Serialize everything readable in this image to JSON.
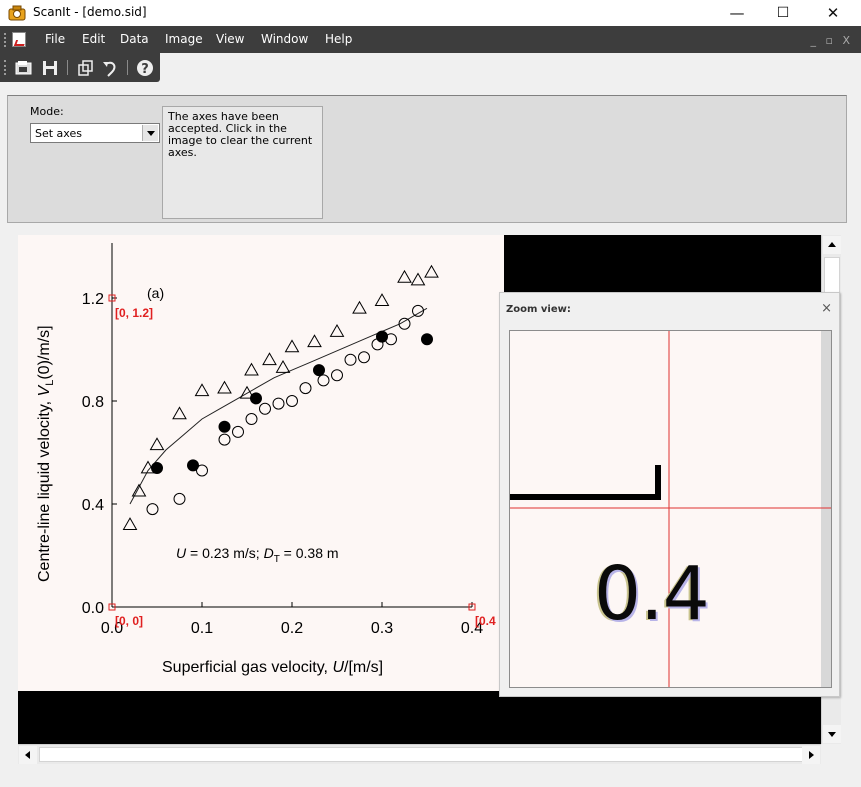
{
  "window": {
    "title": "ScanIt - [demo.sid]",
    "min_glyph": "—",
    "max_glyph": "☐",
    "close_glyph": "✕"
  },
  "menu": {
    "items": [
      "File",
      "Edit",
      "Data",
      "Image",
      "View",
      "Window",
      "Help"
    ],
    "mdi_controls": "_ ▫ X"
  },
  "toolbar": {
    "buttons": [
      "open-icon",
      "save-icon",
      "copy-icon",
      "undo-icon",
      "help-icon"
    ]
  },
  "mode": {
    "label": "Mode:",
    "selected": "Set axes",
    "message": "The axes have been accepted. Click in the image to clear the current axes."
  },
  "zoom": {
    "title": "Zoom view:",
    "close": "×",
    "enlarged_text": "0.4"
  },
  "chart_data": {
    "type": "scatter",
    "panel_label": "(a)",
    "xlabel_text": "Superficial gas velocity, ",
    "xlabel_var": "U",
    "xlabel_unit": "/[m/s]",
    "ylabel_text": "Centre-line liquid velocity, ",
    "ylabel_var": "V",
    "ylabel_sub": "L",
    "ylabel_unit": "(0)/m/s]",
    "annotation": {
      "u_label": "U",
      "u_value": " = 0.23 m/s; ",
      "d_label": "D",
      "d_sub": "T",
      "d_value": " = 0.38 m"
    },
    "xlim": [
      0,
      0.4
    ],
    "ylim": [
      0,
      1.2
    ],
    "x_ticks": [
      "0.0",
      "0.1",
      "0.2",
      "0.3",
      "0.4"
    ],
    "y_ticks": [
      "0.0",
      "0.4",
      "0.8",
      "1.2"
    ],
    "axis_markers": [
      "[0, 1.2]",
      "[0, 0]",
      "[0.4"
    ],
    "series": [
      {
        "marker": "triangle",
        "x": [
          0.02,
          0.03,
          0.04,
          0.05,
          0.075,
          0.1,
          0.125,
          0.15,
          0.155,
          0.175,
          0.19,
          0.2,
          0.225,
          0.25,
          0.275,
          0.3,
          0.325,
          0.34,
          0.355
        ],
        "y": [
          0.32,
          0.45,
          0.54,
          0.63,
          0.75,
          0.84,
          0.85,
          0.83,
          0.92,
          0.96,
          0.93,
          1.01,
          1.03,
          1.07,
          1.16,
          1.19,
          1.28,
          1.27,
          1.3
        ]
      },
      {
        "marker": "circle-open",
        "x": [
          0.045,
          0.075,
          0.1,
          0.125,
          0.14,
          0.155,
          0.17,
          0.185,
          0.2,
          0.215,
          0.235,
          0.25,
          0.265,
          0.28,
          0.295,
          0.31,
          0.325,
          0.34
        ],
        "y": [
          0.38,
          0.42,
          0.53,
          0.65,
          0.68,
          0.73,
          0.77,
          0.79,
          0.8,
          0.85,
          0.88,
          0.9,
          0.96,
          0.97,
          1.02,
          1.04,
          1.1,
          1.15
        ]
      },
      {
        "marker": "circle-filled",
        "x": [
          0.05,
          0.09,
          0.125,
          0.16,
          0.23,
          0.3,
          0.35
        ],
        "y": [
          0.54,
          0.55,
          0.7,
          0.81,
          0.92,
          1.05,
          1.04
        ]
      }
    ],
    "fit_curve": {
      "x": [
        0.02,
        0.04,
        0.06,
        0.08,
        0.1,
        0.12,
        0.14,
        0.16,
        0.18,
        0.2,
        0.22,
        0.24,
        0.26,
        0.28,
        0.3,
        0.32,
        0.35
      ],
      "y": [
        0.4,
        0.53,
        0.61,
        0.67,
        0.73,
        0.77,
        0.81,
        0.85,
        0.89,
        0.92,
        0.95,
        0.98,
        1.01,
        1.04,
        1.07,
        1.1,
        1.16
      ]
    }
  }
}
